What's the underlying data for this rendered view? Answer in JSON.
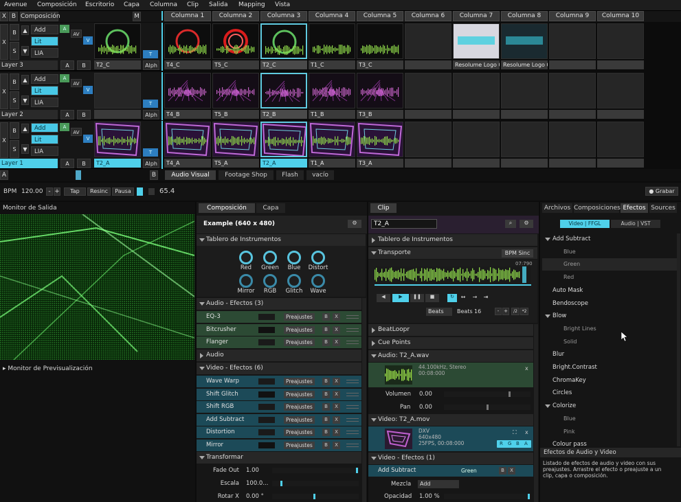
{
  "menu": [
    "Avenue",
    "Composición",
    "Escritorio",
    "Capa",
    "Columna",
    "Clip",
    "Salida",
    "Mapping",
    "Vista"
  ],
  "top": {
    "x": "X",
    "b": "B",
    "comp": "Composición",
    "m": "M"
  },
  "columns": [
    "Columna 1",
    "Columna 2",
    "Columna 3",
    "Columna 4",
    "Columna 5",
    "Columna 6",
    "Columna 7",
    "Columna 8",
    "Columna 9",
    "Columna 10"
  ],
  "layers": [
    {
      "name": "Layer 3",
      "blend": [
        "Add",
        "Lit",
        "LIA"
      ],
      "preview": "T2_C",
      "clips": [
        "T4_C",
        "T5_C",
        "T2_C",
        "T1_C",
        "T3_C",
        "",
        "Resolume Logo 002",
        "Resolume Logo 001",
        "",
        ""
      ]
    },
    {
      "name": "Layer 2",
      "blend": [
        "Add",
        "Lit",
        "LIA"
      ],
      "preview": "",
      "clips": [
        "T4_B",
        "T5_B",
        "T2_B",
        "T1_B",
        "T3_B",
        "",
        "",
        "",
        "",
        ""
      ]
    },
    {
      "name": "Layer 1",
      "blend": [
        "Add",
        "Lit",
        "LIA"
      ],
      "preview": "T2_A",
      "clips": [
        "T4_A",
        "T5_A",
        "T2_A",
        "T1_A",
        "T3_A",
        "",
        "",
        "",
        "",
        ""
      ]
    }
  ],
  "layer_btns": {
    "x": "X",
    "b": "B",
    "s": "S",
    "a": "A",
    "av": "AV",
    "v": "V",
    "t": "T",
    "alph": "Alph"
  },
  "decks": [
    "Audio Visual",
    "Footage Shop",
    "Flash",
    "vacío"
  ],
  "deck_left": "A",
  "deck_right": "B",
  "bpm": {
    "label": "BPM",
    "value": "120.00",
    "minus": "-",
    "plus": "+",
    "tap": "Tap",
    "resync": "Resinc",
    "pause": "Pausa",
    "value2": "65.4",
    "record": "Grabar"
  },
  "output": {
    "title": "Monitor de Salida",
    "preview": "Monitor de Previsualización"
  },
  "comp_tabs": [
    "Composición",
    "Capa"
  ],
  "comp": {
    "title": "Example (640 x 480)",
    "dashboard": "Tablero de Instrumentos",
    "knobs": [
      "Red",
      "Green",
      "Blue",
      "Distort",
      "Mirror",
      "RGB",
      "Glitch",
      "Wave"
    ],
    "audio_fx": "Audio - Efectos (3)",
    "audio_list": [
      "EQ-3",
      "Bitcrusher",
      "Flanger"
    ],
    "audio": "Audio",
    "video_fx": "Video - Efectos (6)",
    "video_list": [
      "Wave Warp",
      "Shift Glitch",
      "Shift RGB",
      "Add Subtract",
      "Distortion",
      "Mirror"
    ],
    "preset": "Preajustes",
    "b": "B",
    "x": "X",
    "transform": "Transformar",
    "params": [
      {
        "label": "Fade Out",
        "value": "1.00"
      },
      {
        "label": "Escala",
        "value": "100.0..."
      },
      {
        "label": "Rotar X",
        "value": "0.00 °"
      }
    ]
  },
  "clip": {
    "tab": "Clip",
    "name": "T2_A",
    "dashboard": "Tablero de Instrumentos",
    "transport": "Transporte",
    "bpm_sync": "BPM Sinc",
    "time": "07:790",
    "beats_sel": "Beats",
    "beats_label": "Beats",
    "beats_val": "16",
    "div2": "/2",
    "mul2": "*2",
    "minus": "-",
    "plus": "+",
    "beatloopr": "BeatLoopr",
    "cue": "Cue Points",
    "audio_file": "Audio: T2_A.wav",
    "audio_info": "44.100kHz, Stereo",
    "audio_time": "00:08:000",
    "volume_label": "Volumen",
    "volume": "0.00",
    "pan_label": "Pan",
    "pan": "0.00",
    "video_file": "Video: T2_A.mov",
    "codec": "DXV",
    "res": "640x480",
    "fps": "25FPS, 00:08:000",
    "rgba": [
      "R",
      "G",
      "B",
      "A"
    ],
    "video_fx": "Video - Efectos (1)",
    "effect": "Add Subtract",
    "effect_val": "Green",
    "mix_label": "Mezcla",
    "mix": "Add",
    "opacity_label": "Opacidad",
    "opacity": "1.00 %",
    "x": "x"
  },
  "right": {
    "tabs": [
      "Archivos",
      "Composiciones",
      "Efectos",
      "Sources"
    ],
    "sub": [
      "Video | FFGL",
      "Audio | VST"
    ],
    "list": [
      {
        "t": "Add Subtract",
        "k": "grp"
      },
      {
        "t": "Blue",
        "k": "sub"
      },
      {
        "t": "Green",
        "k": "sub"
      },
      {
        "t": "Red",
        "k": "sub"
      },
      {
        "t": "Auto Mask",
        "k": "top"
      },
      {
        "t": "Bendoscope",
        "k": "top"
      },
      {
        "t": "Blow",
        "k": "grp"
      },
      {
        "t": "Bright Lines",
        "k": "sub"
      },
      {
        "t": "Solid",
        "k": "sub"
      },
      {
        "t": "Blur",
        "k": "top"
      },
      {
        "t": "Bright.Contrast",
        "k": "top"
      },
      {
        "t": "ChromaKey",
        "k": "top"
      },
      {
        "t": "Circles",
        "k": "top"
      },
      {
        "t": "Colorize",
        "k": "grp"
      },
      {
        "t": "Blue",
        "k": "sub"
      },
      {
        "t": "Pink",
        "k": "sub"
      },
      {
        "t": "Colour pass",
        "k": "top"
      }
    ],
    "info_title": "Efectos de Audio y Video",
    "info_text": "Listado de efectos de audio y video con sus preajustes. Arrastre el efecto o preajuste a un clip, capa o composición."
  },
  "colors": {
    "accent": "#4fd0ea",
    "green": "#2c4a34",
    "blue": "#1c4a58"
  }
}
